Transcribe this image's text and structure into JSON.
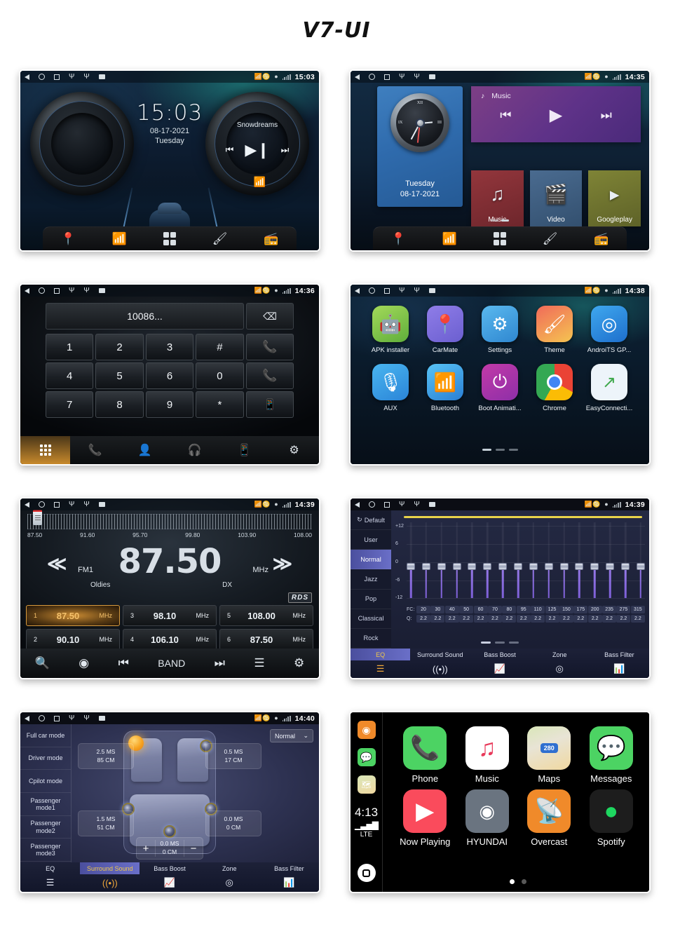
{
  "title": "V7-UI",
  "statusbar": {
    "nav_icons": [
      "back-icon",
      "home-icon",
      "recents-icon",
      "usb-icon",
      "usb-icon",
      "sd-card-icon"
    ],
    "right_icons": [
      "bluetooth-battery-icon",
      "location-icon",
      "signal-icon"
    ]
  },
  "screens": {
    "home": {
      "time": "15:03",
      "clock_time": "15:03",
      "date": "08-17-2021",
      "weekday": "Tuesday",
      "track": "Snowdreams",
      "controls": {
        "prev": "⏮",
        "play_pause": "▶❙",
        "next": "⏭"
      },
      "dock": [
        "navigation-icon",
        "bluetooth-icon",
        "apps-icon",
        "theme-icon",
        "radio-icon"
      ]
    },
    "widgets": {
      "time": "14:35",
      "clock_roman": {
        "xii": "XII",
        "iii": "III",
        "ix": "IX"
      },
      "weekday": "Tuesday",
      "date": "08-17-2021",
      "music_widget": {
        "label": "Music",
        "prev": "⏮",
        "play": "▶",
        "next": "⏭"
      },
      "tiles": [
        {
          "label": "Music",
          "icon": "music-note-icon"
        },
        {
          "label": "Video",
          "icon": "video-clapper-icon"
        },
        {
          "label": "Googleplay",
          "icon": "play-triangle-icon"
        }
      ],
      "dock": [
        "navigation-icon",
        "bluetooth-icon",
        "apps-icon",
        "theme-icon",
        "radio-icon"
      ]
    },
    "dialer": {
      "time": "14:36",
      "number": "10086...",
      "delete_icon": "backspace-icon",
      "keys": [
        "1",
        "2",
        "3",
        "#",
        "call",
        "4",
        "5",
        "6",
        "0",
        "hangup",
        "7",
        "8",
        "9",
        "*",
        "transfer"
      ],
      "dock": [
        "keypad-icon",
        "call-history-icon",
        "contacts-icon",
        "bt-headset-icon",
        "bt-phone-icon",
        "bt-settings-icon"
      ]
    },
    "apps": {
      "time": "14:38",
      "items": [
        {
          "label": "APK installer",
          "icon": "android-icon"
        },
        {
          "label": "CarMate",
          "icon": "carmate-icon"
        },
        {
          "label": "Settings",
          "icon": "car-gear-icon"
        },
        {
          "label": "Theme",
          "icon": "paintbrush-icon"
        },
        {
          "label": "AndroiTS GP...",
          "icon": "gps-satellite-icon"
        },
        {
          "label": "AUX",
          "icon": "aux-plug-icon"
        },
        {
          "label": "Bluetooth",
          "icon": "bluetooth-icon"
        },
        {
          "label": "Boot Animati...",
          "icon": "power-icon"
        },
        {
          "label": "Chrome",
          "icon": "chrome-icon"
        },
        {
          "label": "EasyConnecti...",
          "icon": "easyconnection-icon"
        }
      ],
      "page_dots": 3,
      "page_active": 1
    },
    "radio": {
      "time": "14:39",
      "scale_labels": [
        "87.50",
        "91.60",
        "95.70",
        "99.80",
        "103.90",
        "108.00"
      ],
      "frequency": "87.50",
      "unit": "MHz",
      "band": "FM1",
      "genre": "Oldies",
      "sensitivity": "DX",
      "rds": "RDS",
      "prev_chevron": "≪",
      "next_chevron": "≫",
      "presets": [
        {
          "n": "1",
          "freq": "87.50",
          "unit": "MHz",
          "selected": true
        },
        {
          "n": "2",
          "freq": "90.10",
          "unit": "MHz",
          "selected": false
        },
        {
          "n": "3",
          "freq": "98.10",
          "unit": "MHz",
          "selected": false
        },
        {
          "n": "4",
          "freq": "106.10",
          "unit": "MHz",
          "selected": false
        },
        {
          "n": "5",
          "freq": "108.00",
          "unit": "MHz",
          "selected": false
        },
        {
          "n": "6",
          "freq": "87.50",
          "unit": "MHz",
          "selected": false
        }
      ],
      "dock": [
        "search-icon",
        "scan-icon",
        "prev-track-icon",
        "BAND",
        "next-track-icon",
        "equalizer-icon",
        "settings-icon"
      ]
    },
    "equalizer": {
      "time": "14:39",
      "presets": [
        "Default",
        "User",
        "Normal",
        "Jazz",
        "Pop",
        "Classical",
        "Rock"
      ],
      "active_preset": "Normal",
      "y_labels": [
        "+12",
        "6",
        "0",
        "-6",
        "-12"
      ],
      "fc_label": "FC:",
      "q_label": "Q:",
      "fc_values": [
        "20",
        "30",
        "40",
        "50",
        "60",
        "70",
        "80",
        "95",
        "110",
        "125",
        "150",
        "175",
        "200",
        "235",
        "275",
        "315"
      ],
      "q_values": [
        "2.2",
        "2.2",
        "2.2",
        "2.2",
        "2.2",
        "2.2",
        "2.2",
        "2.2",
        "2.2",
        "2.2",
        "2.2",
        "2.2",
        "2.2",
        "2.2",
        "2.2",
        "2.2"
      ],
      "gain_values": [
        0,
        0,
        0,
        0,
        0,
        0,
        0,
        0,
        0,
        0,
        0,
        0,
        0,
        0,
        0,
        0
      ],
      "tabs": [
        {
          "label": "EQ",
          "icon": "equalizer-icon",
          "active": true
        },
        {
          "label": "Surround Sound",
          "icon": "surround-icon",
          "active": false
        },
        {
          "label": "Bass Boost",
          "icon": "bass-boost-icon",
          "active": false
        },
        {
          "label": "Zone",
          "icon": "zone-icon",
          "active": false
        },
        {
          "label": "Bass Filter",
          "icon": "bass-filter-icon",
          "active": false
        }
      ],
      "page_dots": 3,
      "page_active": 1
    },
    "surround": {
      "time": "14:40",
      "modes": [
        "Full car mode",
        "Driver mode",
        "Cpilot mode",
        "Passenger mode1",
        "Passenger mode2",
        "Passenger mode3"
      ],
      "selector": "Normal",
      "delays": [
        {
          "ms": "2.5 MS",
          "cm": "85 CM",
          "pos": "front-left"
        },
        {
          "ms": "0.5 MS",
          "cm": "17 CM",
          "pos": "front-right"
        },
        {
          "ms": "1.5 MS",
          "cm": "51 CM",
          "pos": "rear-left"
        },
        {
          "ms": "0.0 MS",
          "cm": "0 CM",
          "pos": "rear-right"
        }
      ],
      "sub": {
        "ms": "0.0 MS",
        "cm": "0 CM",
        "plus": "+",
        "minus": "−"
      },
      "tabs": [
        {
          "label": "EQ",
          "icon": "equalizer-icon",
          "active": false
        },
        {
          "label": "Surround Sound",
          "icon": "surround-icon",
          "active": true
        },
        {
          "label": "Bass Boost",
          "icon": "bass-boost-icon",
          "active": false
        },
        {
          "label": "Zone",
          "icon": "zone-icon",
          "active": false
        },
        {
          "label": "Bass Filter",
          "icon": "bass-filter-icon",
          "active": false
        }
      ]
    },
    "carplay": {
      "time": "4:13",
      "network": "LTE",
      "sidebar_icons": [
        "overcast-icon",
        "messages-icon",
        "maps-icon"
      ],
      "home_icon": "carplay-home-icon",
      "apps": [
        {
          "label": "Phone",
          "icon": "phone-icon"
        },
        {
          "label": "Music",
          "icon": "music-note-icon"
        },
        {
          "label": "Maps",
          "icon": "maps-icon",
          "badge": "280"
        },
        {
          "label": "Messages",
          "icon": "messages-icon"
        },
        {
          "label": "Now Playing",
          "icon": "now-playing-icon"
        },
        {
          "label": "HYUNDAI",
          "icon": "hyundai-icon"
        },
        {
          "label": "Overcast",
          "icon": "overcast-icon"
        },
        {
          "label": "Spotify",
          "icon": "spotify-icon"
        }
      ],
      "page_dots": 2,
      "page_active": 1
    }
  }
}
